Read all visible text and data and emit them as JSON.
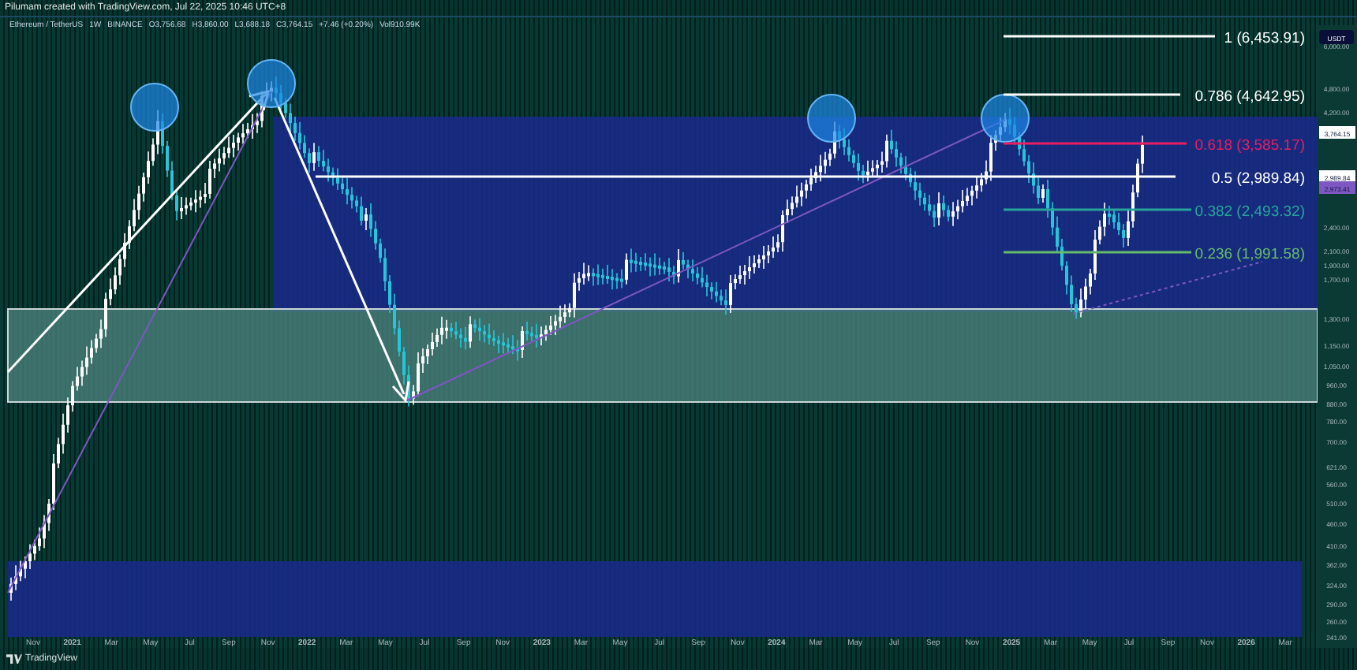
{
  "header": {
    "title": "Pilumam created with TradingView.com, Jul 22, 2025 10:46 UTC+8"
  },
  "legend": {
    "symbol": "Ethereum / TetherUS",
    "interval": "1W",
    "exchange": "BINANCE",
    "open": "O3,756.68",
    "high": "H3,860.00",
    "low": "L3,688.18",
    "close": "C3,764.15",
    "change": "+7.46 (+0.20%)",
    "volume": "Vol910.99K"
  },
  "fib_levels": [
    {
      "label": "1 (6,453.91)",
      "color": "#ffffff"
    },
    {
      "label": "0.786 (4,642.95)",
      "color": "#ffffff"
    },
    {
      "label": "0.618 (3,585.17)",
      "color": "#e91e63"
    },
    {
      "label": "0.5 (2,989.84)",
      "color": "#ffffff"
    },
    {
      "label": "0.382 (2,493.32)",
      "color": "#26a69a"
    },
    {
      "label": "0.236 (1,991.58)",
      "color": "#66bb6a"
    }
  ],
  "price_axis": {
    "currency": "USDT",
    "ticks": [
      "6,000.00",
      "4,800.00",
      "4,200.00",
      "2,400.00",
      "2,100.00",
      "1,900.00",
      "1,700.00",
      "1,300.00",
      "1,150.00",
      "1,050.00",
      "960.00",
      "880.00",
      "780.00",
      "700.00",
      "621.00",
      "560.00",
      "510.00",
      "460.00",
      "410.00",
      "362.00",
      "324.00",
      "290.00",
      "260.00",
      "241.00"
    ],
    "price_tags": [
      {
        "label": "3,764.15",
        "color": "#ffffff"
      },
      {
        "label": "2,989.84",
        "color": "#ffffff"
      },
      {
        "label": "2,973.41",
        "color": "#7e57c2"
      }
    ]
  },
  "time_axis": [
    "Nov",
    "2021",
    "Mar",
    "May",
    "Jul",
    "Sep",
    "Nov",
    "2022",
    "Mar",
    "May",
    "Jul",
    "Sep",
    "Nov",
    "2023",
    "Mar",
    "May",
    "Jul",
    "Sep",
    "Nov",
    "2024",
    "Mar",
    "May",
    "Jul",
    "Sep",
    "Nov",
    "2025",
    "Mar",
    "May",
    "Jul",
    "Sep",
    "Nov",
    "2026",
    "Mar"
  ],
  "logo": "TradingView"
}
